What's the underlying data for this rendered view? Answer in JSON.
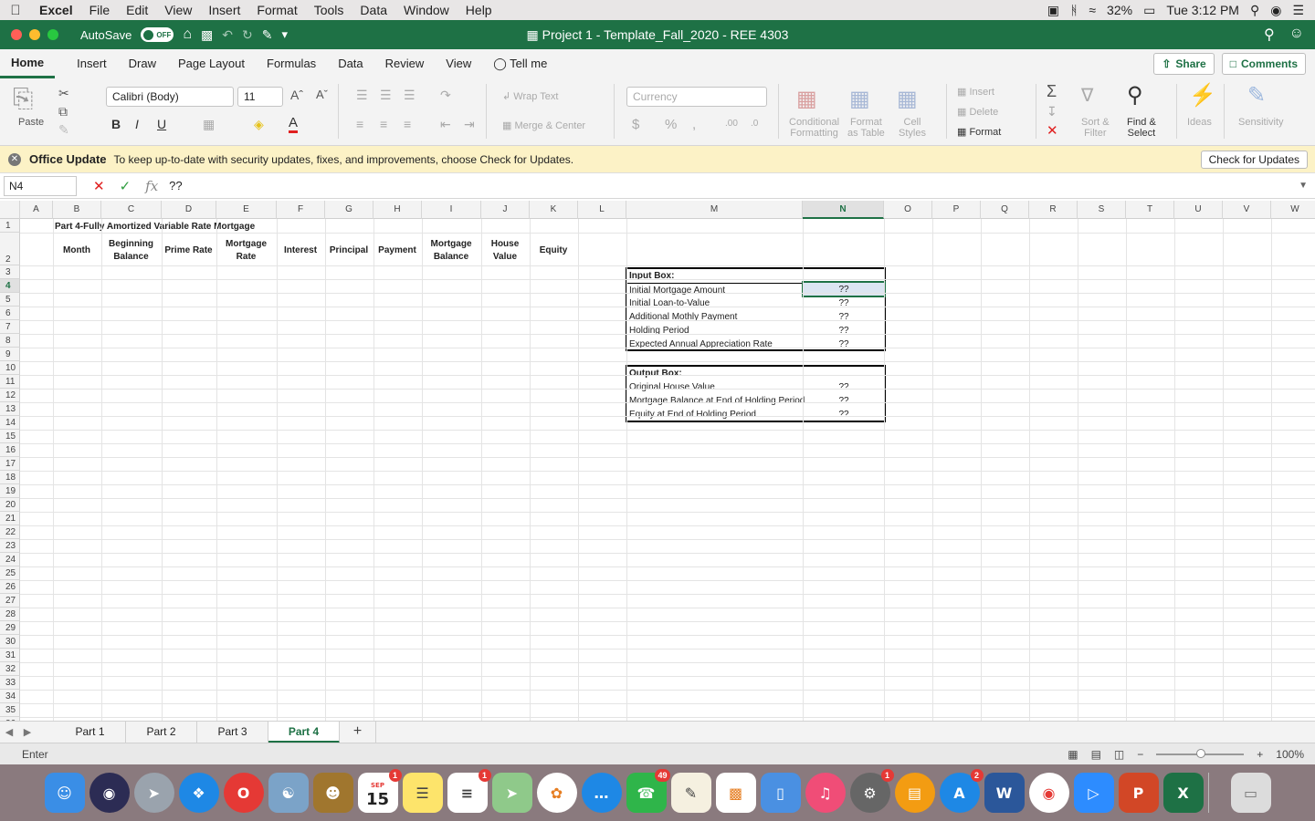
{
  "menubar": {
    "app_name": "Excel",
    "items": [
      "File",
      "Edit",
      "View",
      "Insert",
      "Format",
      "Tools",
      "Data",
      "Window",
      "Help"
    ],
    "battery": "32%",
    "clock": "Tue 3:12 PM"
  },
  "titlebar": {
    "autosave_label": "AutoSave",
    "autosave_state": "OFF",
    "doc_title": "Project 1 - Template_Fall_2020 - REE 4303"
  },
  "ribbon_tabs": [
    "Home",
    "Insert",
    "Draw",
    "Page Layout",
    "Formulas",
    "Data",
    "Review",
    "View",
    "Tell me"
  ],
  "share_label": "Share",
  "comments_label": "Comments",
  "ribbon": {
    "paste": "Paste",
    "font_name": "Calibri (Body)",
    "font_size": "11",
    "wrap_text": "Wrap Text",
    "merge_center": "Merge & Center",
    "number_format": "Currency",
    "conditional": "Conditional\nFormatting",
    "format_table": "Format\nas Table",
    "cell_styles": "Cell\nStyles",
    "insert": "Insert",
    "delete": "Delete",
    "format": "Format",
    "sort_filter": "Sort &\nFilter",
    "find_select": "Find &\nSelect",
    "ideas": "Ideas",
    "sensitivity": "Sensitivity"
  },
  "notice": {
    "title": "Office Update",
    "text": "To keep up-to-date with security updates, fixes, and improvements, choose Check for Updates.",
    "button": "Check for Updates"
  },
  "formula_bar": {
    "name_box": "N4",
    "value": "??"
  },
  "columns": [
    "A",
    "B",
    "C",
    "D",
    "E",
    "F",
    "G",
    "H",
    "I",
    "J",
    "K",
    "L",
    "M",
    "N",
    "O",
    "P",
    "Q",
    "R",
    "S",
    "T",
    "U",
    "V",
    "W"
  ],
  "selected_column": "N",
  "selected_row": 4,
  "sheet": {
    "title": "Part 4-Fully Amortized Variable Rate Mortgage",
    "headers": [
      "Month",
      "Beginning Balance",
      "Prime Rate",
      "Mortgage Rate",
      "Interest",
      "Principal",
      "Payment",
      "Mortgage Balance",
      "House Value",
      "Equity"
    ],
    "input_box": {
      "title": "Input Box:",
      "rows": [
        {
          "label": "Initial Mortgage Amount",
          "value": "??"
        },
        {
          "label": "Initial Loan-to-Value",
          "value": "??"
        },
        {
          "label": "Additional Mothly Payment",
          "value": "??"
        },
        {
          "label": "Holding Period",
          "value": "??"
        },
        {
          "label": "Expected Annual Appreciation Rate",
          "value": "??"
        }
      ]
    },
    "output_box": {
      "title": "Output Box:",
      "rows": [
        {
          "label": "Original House Value",
          "value": "??"
        },
        {
          "label": "Mortgage Balance at End of Holding Period",
          "value": "??"
        },
        {
          "label": "Equity at End of Holding Period",
          "value": "??"
        }
      ]
    }
  },
  "sheet_tabs": [
    "Part 1",
    "Part 2",
    "Part 3",
    "Part 4"
  ],
  "active_sheet": "Part 4",
  "status": {
    "mode": "Enter",
    "zoom": "100%"
  },
  "dock_badges": {
    "calendar": "1",
    "reminders": "1",
    "facetime": "49",
    "system_prefs": "1",
    "appstore": "2"
  },
  "calendar_day": "15",
  "calendar_month": "SEP"
}
